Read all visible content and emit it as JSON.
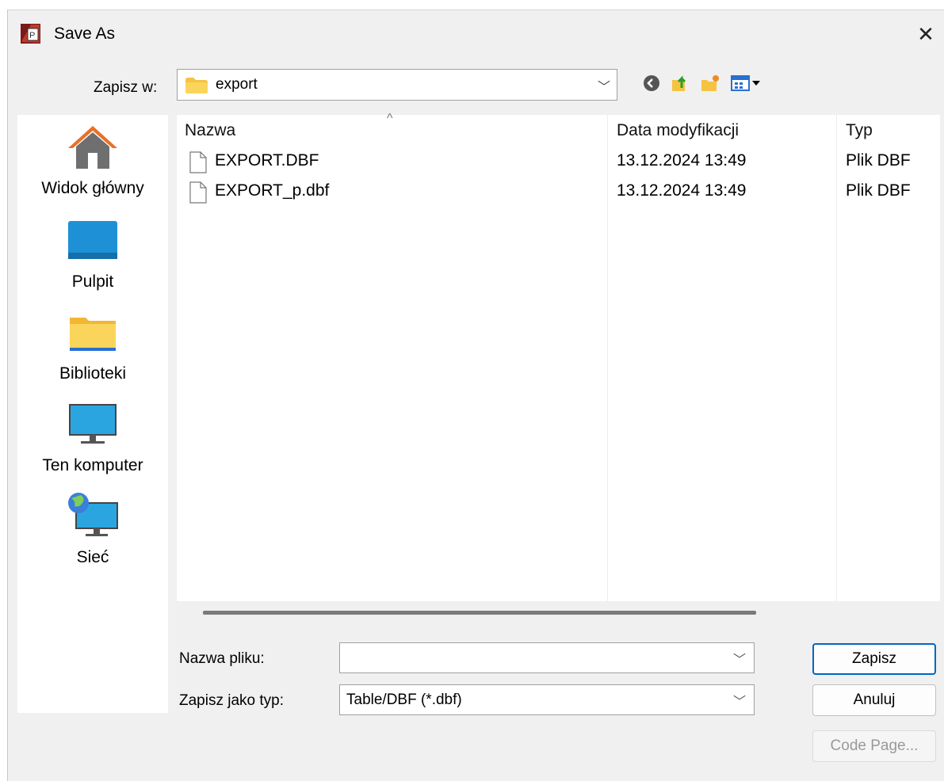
{
  "window": {
    "title": "Save As",
    "close": "✕"
  },
  "toolbar": {
    "save_in_label": "Zapisz w:",
    "save_in_value": "export"
  },
  "places": [
    {
      "label": "Widok główny",
      "icon": "home-icon"
    },
    {
      "label": "Pulpit",
      "icon": "desktop-icon"
    },
    {
      "label": "Biblioteki",
      "icon": "libraries-icon"
    },
    {
      "label": "Ten komputer",
      "icon": "computer-icon"
    },
    {
      "label": "Sieć",
      "icon": "network-icon"
    }
  ],
  "files": {
    "headers": {
      "name": "Nazwa",
      "date": "Data modyfikacji",
      "type": "Typ"
    },
    "sort_indicator": "^",
    "rows": [
      {
        "name": "EXPORT.DBF",
        "date": "13.12.2024 13:49",
        "type": "Plik DBF"
      },
      {
        "name": "EXPORT_p.dbf",
        "date": "13.12.2024 13:49",
        "type": "Plik DBF"
      }
    ]
  },
  "form": {
    "filename_label": "Nazwa pliku:",
    "filename_value": "",
    "filetype_label": "Zapisz jako typ:",
    "filetype_value": "Table/DBF (*.dbf)"
  },
  "buttons": {
    "save": "Zapisz",
    "cancel": "Anuluj",
    "codepage": "Code Page..."
  },
  "colors": {
    "accent": "#0067c0",
    "folder": "#f5c342",
    "monitor": "#1e90d6"
  }
}
